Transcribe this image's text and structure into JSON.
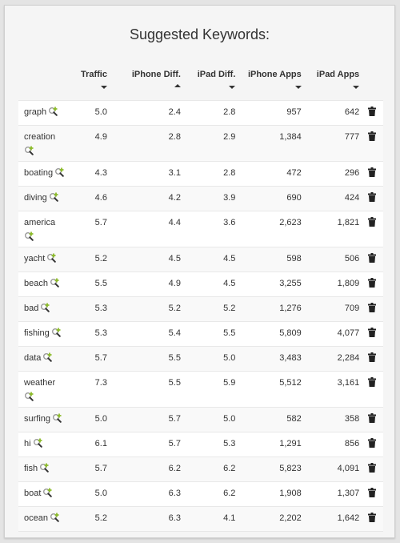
{
  "title": "Suggested Keywords:",
  "columns": [
    {
      "label": "Traffic",
      "sort": "desc"
    },
    {
      "label": "iPhone Diff.",
      "sort": "asc"
    },
    {
      "label": "iPad Diff.",
      "sort": "desc"
    },
    {
      "label": "iPhone Apps",
      "sort": "desc"
    },
    {
      "label": "iPad Apps",
      "sort": "desc"
    }
  ],
  "icons": {
    "add": "search-add-icon",
    "delete": "trash-icon"
  },
  "colors": {
    "add_plus": "#8cbb2a",
    "trash": "#222222"
  },
  "rows": [
    {
      "keyword": "graph",
      "traffic": "5.0",
      "iphone_diff": "2.4",
      "ipad_diff": "2.8",
      "iphone_apps": "957",
      "ipad_apps": "642",
      "wrap": false
    },
    {
      "keyword": "creation",
      "traffic": "4.9",
      "iphone_diff": "2.8",
      "ipad_diff": "2.9",
      "iphone_apps": "1,384",
      "ipad_apps": "777",
      "wrap": true
    },
    {
      "keyword": "boating",
      "traffic": "4.3",
      "iphone_diff": "3.1",
      "ipad_diff": "2.8",
      "iphone_apps": "472",
      "ipad_apps": "296",
      "wrap": false
    },
    {
      "keyword": "diving",
      "traffic": "4.6",
      "iphone_diff": "4.2",
      "ipad_diff": "3.9",
      "iphone_apps": "690",
      "ipad_apps": "424",
      "wrap": false
    },
    {
      "keyword": "america",
      "traffic": "5.7",
      "iphone_diff": "4.4",
      "ipad_diff": "3.6",
      "iphone_apps": "2,623",
      "ipad_apps": "1,821",
      "wrap": true
    },
    {
      "keyword": "yacht",
      "traffic": "5.2",
      "iphone_diff": "4.5",
      "ipad_diff": "4.5",
      "iphone_apps": "598",
      "ipad_apps": "506",
      "wrap": false
    },
    {
      "keyword": "beach",
      "traffic": "5.5",
      "iphone_diff": "4.9",
      "ipad_diff": "4.5",
      "iphone_apps": "3,255",
      "ipad_apps": "1,809",
      "wrap": false
    },
    {
      "keyword": "bad",
      "traffic": "5.3",
      "iphone_diff": "5.2",
      "ipad_diff": "5.2",
      "iphone_apps": "1,276",
      "ipad_apps": "709",
      "wrap": false
    },
    {
      "keyword": "fishing",
      "traffic": "5.3",
      "iphone_diff": "5.4",
      "ipad_diff": "5.5",
      "iphone_apps": "5,809",
      "ipad_apps": "4,077",
      "wrap": false
    },
    {
      "keyword": "data",
      "traffic": "5.7",
      "iphone_diff": "5.5",
      "ipad_diff": "5.0",
      "iphone_apps": "3,483",
      "ipad_apps": "2,284",
      "wrap": false
    },
    {
      "keyword": "weather",
      "traffic": "7.3",
      "iphone_diff": "5.5",
      "ipad_diff": "5.9",
      "iphone_apps": "5,512",
      "ipad_apps": "3,161",
      "wrap": true
    },
    {
      "keyword": "surfing",
      "traffic": "5.0",
      "iphone_diff": "5.7",
      "ipad_diff": "5.0",
      "iphone_apps": "582",
      "ipad_apps": "358",
      "wrap": false
    },
    {
      "keyword": "hi",
      "traffic": "6.1",
      "iphone_diff": "5.7",
      "ipad_diff": "5.3",
      "iphone_apps": "1,291",
      "ipad_apps": "856",
      "wrap": false
    },
    {
      "keyword": "fish",
      "traffic": "5.7",
      "iphone_diff": "6.2",
      "ipad_diff": "6.2",
      "iphone_apps": "5,823",
      "ipad_apps": "4,091",
      "wrap": false
    },
    {
      "keyword": "boat",
      "traffic": "5.0",
      "iphone_diff": "6.3",
      "ipad_diff": "6.2",
      "iphone_apps": "1,908",
      "ipad_apps": "1,307",
      "wrap": false
    },
    {
      "keyword": "ocean",
      "traffic": "5.2",
      "iphone_diff": "6.3",
      "ipad_diff": "4.1",
      "iphone_apps": "2,202",
      "ipad_apps": "1,642",
      "wrap": false
    }
  ]
}
